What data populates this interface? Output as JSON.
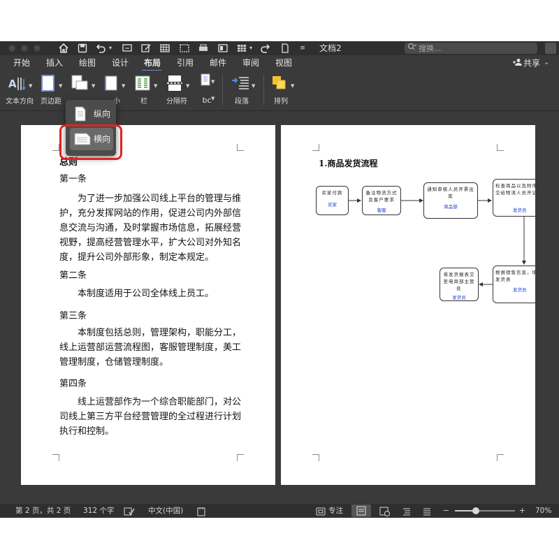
{
  "titlebar": {
    "doc_title": "文档2",
    "search_placeholder": "搜换..."
  },
  "tabs": [
    "开始",
    "插入",
    "绘图",
    "设计",
    "布局",
    "引用",
    "邮件",
    "审阅",
    "视图"
  ],
  "active_tab": "布局",
  "share_label": "共享",
  "ribbon": {
    "text_direction": "文本方向",
    "margins": "页边距",
    "size_partial": "小",
    "columns": "栏",
    "breaks": "分隔符",
    "paragraph": "段落",
    "arrange": "排列",
    "line_numbers_glyph": "bc"
  },
  "orientation_menu": {
    "portrait": "纵向",
    "landscape": "横向",
    "highlighted": "横向"
  },
  "page1": {
    "heading": "总则",
    "sections": [
      {
        "title": "第一条",
        "body": "为了进一步加强公司线上平台的管理与维护，充分发挥网站的作用，促进公司内外部信息交流与沟通，及时掌握市场信息，拓展经营视野，提高经营管理水平，扩大公司对外知名度，提升公司外部形象，制定本规定。"
      },
      {
        "title": "第二条",
        "body": "本制度适用于公司全体线上员工。"
      },
      {
        "title": "第三条",
        "body": "本制度包括总则，管理架构，职能分工，线上运营部运营流程图，客服管理制度，美工管理制度，仓储管理制度。"
      },
      {
        "title": "第四条",
        "body": "线上运营部作为一个综合职能部门，对公司线上第三方平台经营管理的全过程进行计划执行和控制。"
      }
    ]
  },
  "page2": {
    "title": "1.商品发货流程",
    "flow": [
      {
        "text": "买家付款",
        "dept": "买家"
      },
      {
        "text": "备注物流方式及客户要求",
        "dept": "客服"
      },
      {
        "text": "通知审核人员开票出库",
        "dept": "商品部"
      },
      {
        "text": "检查商品以及附件包交给物流人员开记录",
        "dept": "发货员"
      },
      {
        "text": "根据销售信息，填写发货表",
        "dept": "发货员"
      },
      {
        "text": "将发货报表交至电商部主管处",
        "dept": "发货员"
      }
    ]
  },
  "statusbar": {
    "page_info": "第 2 页，共 2 页",
    "word_count": "312 个字",
    "language": "中文(中国)",
    "focus": "专注",
    "zoom_minus": "−",
    "zoom_plus": "+",
    "zoom": "70%"
  },
  "zoom_level": 0.35,
  "colors": {
    "highlight_border": "#e0241f",
    "flow_dept_text": "#1b3fd8",
    "tab_underline": "#6f8fd8"
  }
}
